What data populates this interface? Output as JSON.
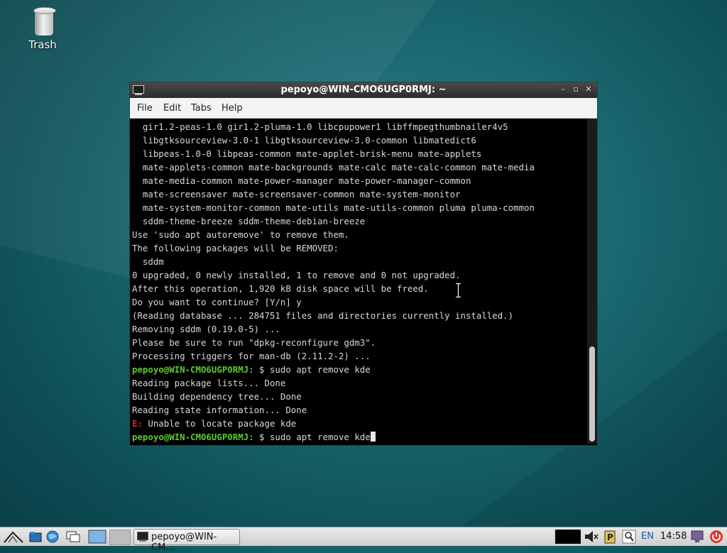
{
  "desktop": {
    "trash_label": "Trash"
  },
  "window": {
    "title": "pepoyo@WIN-CMO6UGP0RMJ: ~",
    "menu": [
      "File",
      "Edit",
      "Tabs",
      "Help"
    ],
    "minimize_glyph": "–",
    "maximize_glyph": "▫",
    "close_glyph": "✕"
  },
  "terminal": {
    "lines": [
      "  gir1.2-peas-1.0 gir1.2-pluma-1.0 libcpupower1 libffmpegthumbnailer4v5",
      "  libgtksourceview-3.0-1 libgtksourceview-3.0-common libmatedict6",
      "  libpeas-1.0-0 libpeas-common mate-applet-brisk-menu mate-applets",
      "  mate-applets-common mate-backgrounds mate-calc mate-calc-common mate-media",
      "  mate-media-common mate-power-manager mate-power-manager-common",
      "  mate-screensaver mate-screensaver-common mate-system-monitor",
      "  mate-system-monitor-common mate-utils mate-utils-common pluma pluma-common",
      "  sddm-theme-breeze sddm-theme-debian-breeze",
      "Use 'sudo apt autoremove' to remove them.",
      "The following packages will be REMOVED:",
      "  sddm",
      "0 upgraded, 0 newly installed, 1 to remove and 0 not upgraded.",
      "After this operation, 1,920 kB disk space will be freed.",
      "Do you want to continue? [Y/n] y",
      "(Reading database ... 284751 files and directories currently installed.)",
      "Removing sddm (0.19.0-5) ...",
      "Please be sure to run \"dpkg-reconfigure gdm3\".",
      "Processing triggers for man-db (2.11.2-2) ..."
    ],
    "prompt1_user": "pepoyo@WIN-CMO6UGP0RMJ",
    "prompt1_cmd": ": $ sudo apt remove kde",
    "after_lines": [
      "Reading package lists... Done",
      "Building dependency tree... Done",
      "Reading state information... Done"
    ],
    "error_prefix": "E:",
    "error_msg": " Unable to locate package kde",
    "prompt2_user": "pepoyo@WIN-CMO6UGP0RMJ",
    "prompt2_cmd": ": $ sudo apt remove kde"
  },
  "taskbar": {
    "task_label": "pepoyo@WIN-CM...",
    "language": "EN",
    "clock": "14:58",
    "accent": "#1c6b73"
  }
}
